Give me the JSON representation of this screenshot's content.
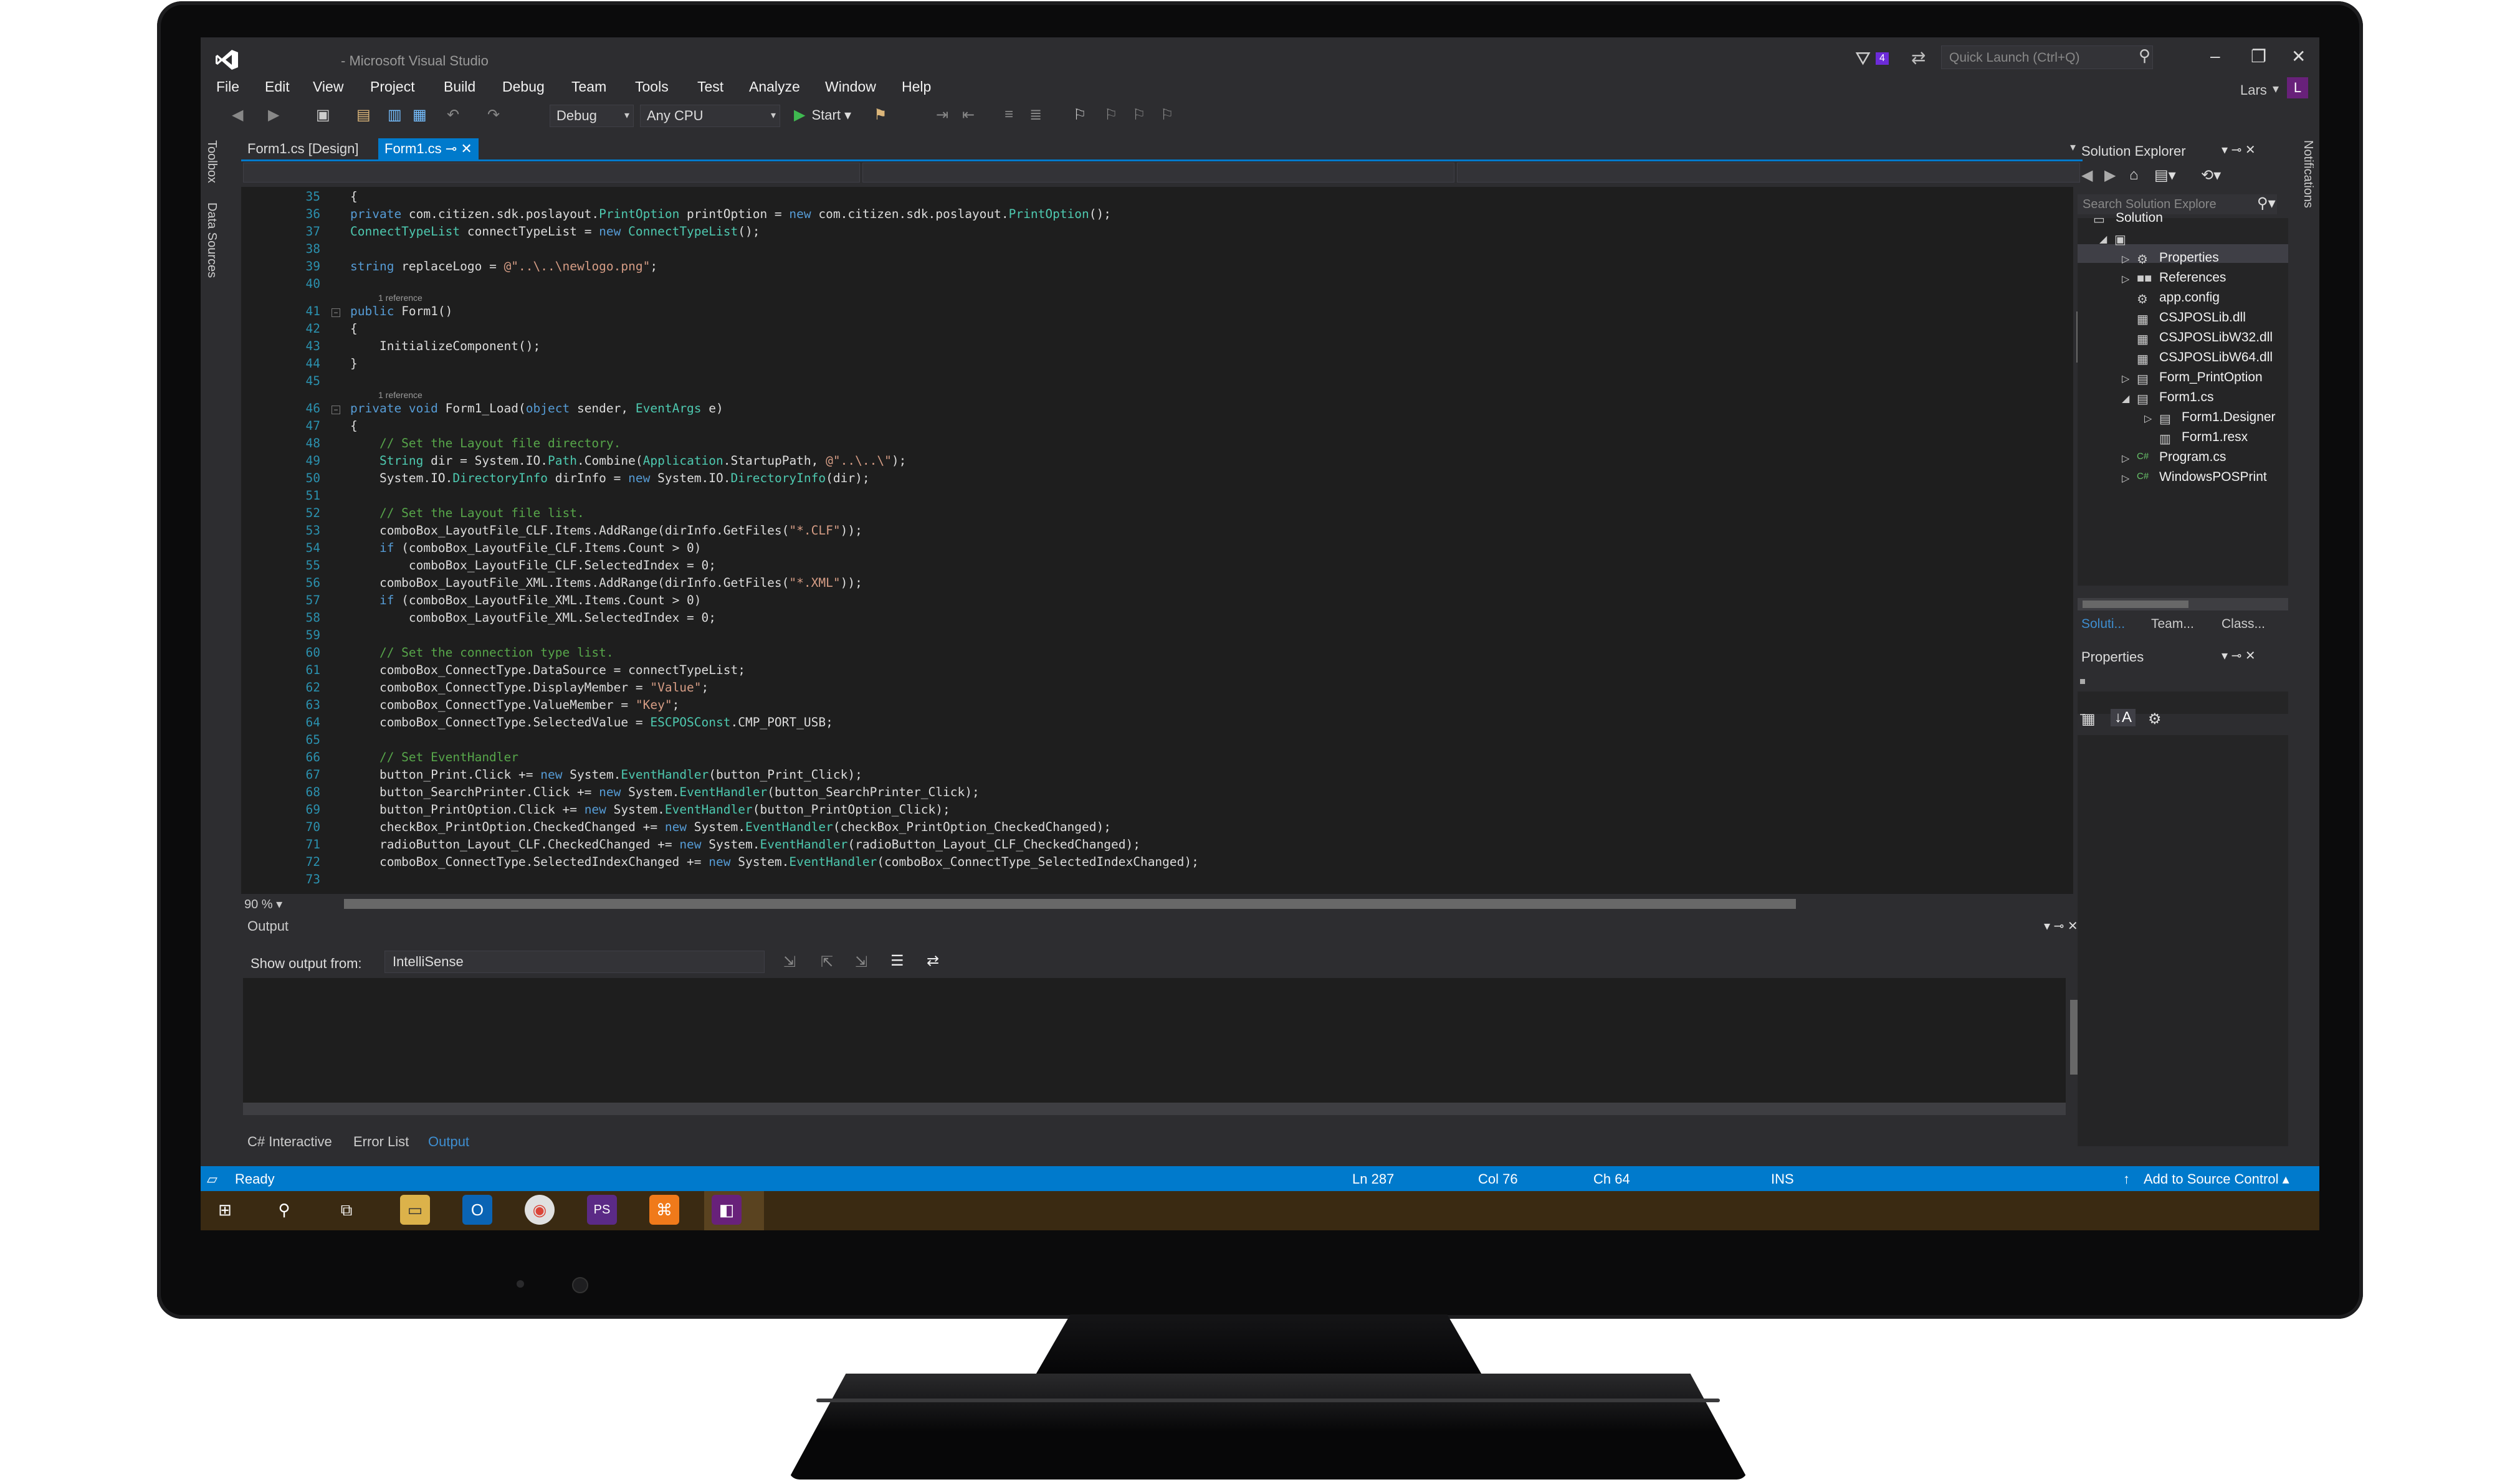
{
  "window": {
    "title": "- Microsoft Visual Studio",
    "notification_count": "4",
    "quick_launch_placeholder": "Quick Launch (Ctrl+Q)",
    "user_name": "Lars",
    "user_initial": "L"
  },
  "menu": [
    "File",
    "Edit",
    "View",
    "Project",
    "Build",
    "Debug",
    "Team",
    "Tools",
    "Test",
    "Analyze",
    "Window",
    "Help"
  ],
  "toolbar": {
    "configuration": "Debug",
    "platform": "Any CPU",
    "start_label": "Start"
  },
  "side_tabs": {
    "toolbox": "Toolbox",
    "data_sources": "Data Sources",
    "notifications": "Notifications"
  },
  "doc_tabs": [
    {
      "label": "Form1.cs [Design]"
    },
    {
      "label": "Form1.cs"
    }
  ],
  "editor": {
    "zoom": "90 %",
    "lines": [
      {
        "n": "35",
        "code": [
          [
            "tx",
            "{"
          ]
        ]
      },
      {
        "n": "36",
        "code": [
          [
            "kw",
            "private "
          ],
          [
            "tx",
            "com.citizen.sdk.poslayout."
          ],
          [
            "ty",
            "PrintOption"
          ],
          [
            "tx",
            " printOption = "
          ],
          [
            "kw",
            "new "
          ],
          [
            "tx",
            "com.citizen.sdk.poslayout."
          ],
          [
            "ty",
            "PrintOption"
          ],
          [
            "tx",
            "();"
          ]
        ]
      },
      {
        "n": "37",
        "code": [
          [
            "ty",
            "ConnectTypeList"
          ],
          [
            "tx",
            " connectTypeList = "
          ],
          [
            "kw",
            "new "
          ],
          [
            "ty",
            "ConnectTypeList"
          ],
          [
            "tx",
            "();"
          ]
        ]
      },
      {
        "n": "38",
        "code": []
      },
      {
        "n": "39",
        "code": [
          [
            "kw",
            "string "
          ],
          [
            "tx",
            "replaceLogo = "
          ],
          [
            "st",
            "@\"..\\..\\newlogo.png\""
          ],
          [
            "tx",
            ";"
          ]
        ]
      },
      {
        "n": "40",
        "code": []
      },
      {
        "n": "41",
        "ref": "1 reference",
        "code": [
          [
            "kw",
            "public "
          ],
          [
            "tx",
            "Form1()"
          ]
        ]
      },
      {
        "n": "42",
        "code": [
          [
            "tx",
            "{"
          ]
        ]
      },
      {
        "n": "43",
        "code": [
          [
            "tx",
            "    InitializeComponent();"
          ]
        ]
      },
      {
        "n": "44",
        "code": [
          [
            "tx",
            "}"
          ]
        ]
      },
      {
        "n": "45",
        "code": []
      },
      {
        "n": "46",
        "ref": "1 reference",
        "code": [
          [
            "kw",
            "private void "
          ],
          [
            "tx",
            "Form1_Load("
          ],
          [
            "kw",
            "object "
          ],
          [
            "tx",
            "sender, "
          ],
          [
            "ty",
            "EventArgs"
          ],
          [
            "tx",
            " e)"
          ]
        ]
      },
      {
        "n": "47",
        "code": [
          [
            "tx",
            "{"
          ]
        ]
      },
      {
        "n": "48",
        "code": [
          [
            "cm",
            "    // Set the Layout file directory."
          ]
        ]
      },
      {
        "n": "49",
        "code": [
          [
            "ty",
            "    String"
          ],
          [
            "tx",
            " dir = System.IO."
          ],
          [
            "ty",
            "Path"
          ],
          [
            "tx",
            ".Combine("
          ],
          [
            "ty",
            "Application"
          ],
          [
            "tx",
            ".StartupPath, "
          ],
          [
            "st",
            "@\"..\\..\\\""
          ],
          [
            "tx",
            ");"
          ]
        ]
      },
      {
        "n": "50",
        "code": [
          [
            "tx",
            "    System.IO."
          ],
          [
            "ty",
            "DirectoryInfo"
          ],
          [
            "tx",
            " dirInfo = "
          ],
          [
            "kw",
            "new "
          ],
          [
            "tx",
            "System.IO."
          ],
          [
            "ty",
            "DirectoryInfo"
          ],
          [
            "tx",
            "(dir);"
          ]
        ]
      },
      {
        "n": "51",
        "code": []
      },
      {
        "n": "52",
        "code": [
          [
            "cm",
            "    // Set the Layout file list."
          ]
        ]
      },
      {
        "n": "53",
        "code": [
          [
            "tx",
            "    comboBox_LayoutFile_CLF.Items.AddRange(dirInfo.GetFiles("
          ],
          [
            "st",
            "\"*.CLF\""
          ],
          [
            "tx",
            "));"
          ]
        ]
      },
      {
        "n": "54",
        "code": [
          [
            "kw",
            "    if "
          ],
          [
            "tx",
            "(comboBox_LayoutFile_CLF.Items.Count > 0)"
          ]
        ]
      },
      {
        "n": "55",
        "code": [
          [
            "tx",
            "        comboBox_LayoutFile_CLF.SelectedIndex = 0;"
          ]
        ]
      },
      {
        "n": "56",
        "code": [
          [
            "tx",
            "    comboBox_LayoutFile_XML.Items.AddRange(dirInfo.GetFiles("
          ],
          [
            "st",
            "\"*.XML\""
          ],
          [
            "tx",
            "));"
          ]
        ]
      },
      {
        "n": "57",
        "code": [
          [
            "kw",
            "    if "
          ],
          [
            "tx",
            "(comboBox_LayoutFile_XML.Items.Count > 0)"
          ]
        ]
      },
      {
        "n": "58",
        "code": [
          [
            "tx",
            "        comboBox_LayoutFile_XML.SelectedIndex = 0;"
          ]
        ]
      },
      {
        "n": "59",
        "code": []
      },
      {
        "n": "60",
        "code": [
          [
            "cm",
            "    // Set the connection type list."
          ]
        ]
      },
      {
        "n": "61",
        "code": [
          [
            "tx",
            "    comboBox_ConnectType.DataSource = connectTypeList;"
          ]
        ]
      },
      {
        "n": "62",
        "code": [
          [
            "tx",
            "    comboBox_ConnectType.DisplayMember = "
          ],
          [
            "st",
            "\"Value\""
          ],
          [
            "tx",
            ";"
          ]
        ]
      },
      {
        "n": "63",
        "code": [
          [
            "tx",
            "    comboBox_ConnectType.ValueMember = "
          ],
          [
            "st",
            "\"Key\""
          ],
          [
            "tx",
            ";"
          ]
        ]
      },
      {
        "n": "64",
        "code": [
          [
            "tx",
            "    comboBox_ConnectType.SelectedValue = "
          ],
          [
            "ty",
            "ESCPOSConst"
          ],
          [
            "tx",
            ".CMP_PORT_USB;"
          ]
        ]
      },
      {
        "n": "65",
        "code": []
      },
      {
        "n": "66",
        "code": [
          [
            "cm",
            "    // Set EventHandler"
          ]
        ]
      },
      {
        "n": "67",
        "code": [
          [
            "tx",
            "    button_Print.Click += "
          ],
          [
            "kw",
            "new "
          ],
          [
            "tx",
            "System."
          ],
          [
            "ty",
            "EventHandler"
          ],
          [
            "tx",
            "(button_Print_Click);"
          ]
        ]
      },
      {
        "n": "68",
        "code": [
          [
            "tx",
            "    button_SearchPrinter.Click += "
          ],
          [
            "kw",
            "new "
          ],
          [
            "tx",
            "System."
          ],
          [
            "ty",
            "EventHandler"
          ],
          [
            "tx",
            "(button_SearchPrinter_Click);"
          ]
        ]
      },
      {
        "n": "69",
        "code": [
          [
            "tx",
            "    button_PrintOption.Click += "
          ],
          [
            "kw",
            "new "
          ],
          [
            "tx",
            "System."
          ],
          [
            "ty",
            "EventHandler"
          ],
          [
            "tx",
            "(button_PrintOption_Click);"
          ]
        ]
      },
      {
        "n": "70",
        "code": [
          [
            "tx",
            "    checkBox_PrintOption.CheckedChanged += "
          ],
          [
            "kw",
            "new "
          ],
          [
            "tx",
            "System."
          ],
          [
            "ty",
            "EventHandler"
          ],
          [
            "tx",
            "(checkBox_PrintOption_CheckedChanged);"
          ]
        ]
      },
      {
        "n": "71",
        "code": [
          [
            "tx",
            "    radioButton_Layout_CLF.CheckedChanged += "
          ],
          [
            "kw",
            "new "
          ],
          [
            "tx",
            "System."
          ],
          [
            "ty",
            "EventHandler"
          ],
          [
            "tx",
            "(radioButton_Layout_CLF_CheckedChanged);"
          ]
        ]
      },
      {
        "n": "72",
        "code": [
          [
            "tx",
            "    comboBox_ConnectType.SelectedIndexChanged += "
          ],
          [
            "kw",
            "new "
          ],
          [
            "tx",
            "System."
          ],
          [
            "ty",
            "EventHandler"
          ],
          [
            "tx",
            "(comboBox_ConnectType_SelectedIndexChanged);"
          ]
        ]
      },
      {
        "n": "73",
        "code": []
      }
    ]
  },
  "output": {
    "title": "Output",
    "show_from_label": "Show output from:",
    "source": "IntelliSense"
  },
  "bottom_tabs": [
    "C# Interactive",
    "Error List",
    "Output"
  ],
  "solution_explorer": {
    "title": "Solution Explorer",
    "search_placeholder": "Search Solution Explore",
    "items": [
      {
        "label": "Solution",
        "level": 0
      },
      {
        "label": "",
        "level": 0
      },
      {
        "label": "Properties",
        "level": 1
      },
      {
        "label": "References",
        "level": 1
      },
      {
        "label": "app.config",
        "level": 1
      },
      {
        "label": "CSJPOSLib.dll",
        "level": 1
      },
      {
        "label": "CSJPOSLibW32.dll",
        "level": 1
      },
      {
        "label": "CSJPOSLibW64.dll",
        "level": 1
      },
      {
        "label": "Form_PrintOption",
        "level": 1
      },
      {
        "label": "Form1.cs",
        "level": 1
      },
      {
        "label": "Form1.Designer",
        "level": 2
      },
      {
        "label": "Form1.resx",
        "level": 2
      },
      {
        "label": "Program.cs",
        "level": 1
      },
      {
        "label": "WindowsPOSPrint",
        "level": 1
      }
    ],
    "tabs": [
      "Soluti...",
      "Team...",
      "Class..."
    ]
  },
  "properties_panel": {
    "title": "Properties"
  },
  "status": {
    "ready": "Ready",
    "line": "Ln 287",
    "col": "Col 76",
    "ch": "Ch 64",
    "mode": "INS",
    "source_control": "Add to Source Control"
  },
  "colors": {
    "accent": "#007acc",
    "background": "#2d2d30",
    "editor": "#1e1e1e",
    "keyword": "#569cd6",
    "type": "#4ec9b0",
    "string": "#d69d85",
    "comment": "#57a64a",
    "taskbar": "#3a2a12"
  },
  "taskbar": {
    "icons": [
      "windows-start-icon",
      "search-icon",
      "task-view-icon",
      "file-explorer-icon",
      "outlook-icon",
      "chrome-icon",
      "phpstorm-icon",
      "xampp-icon",
      "visual-studio-icon"
    ]
  }
}
